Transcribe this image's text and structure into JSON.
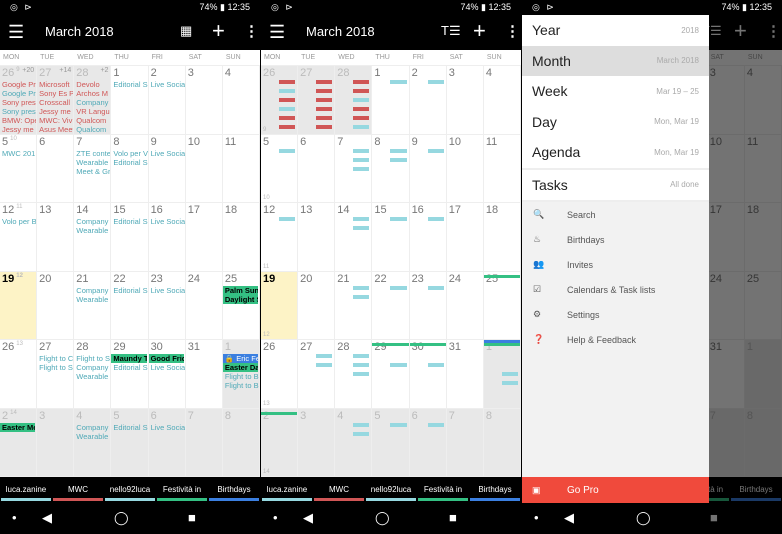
{
  "status": {
    "left_icons": "◎ ⊳",
    "right": "74% ▮ 12:35"
  },
  "appbar": {
    "menu_icon": "☰",
    "title": "March 2018",
    "action1_p1": "▦",
    "action1_p2": "T☰",
    "add": "+",
    "more": "⋮"
  },
  "dow": [
    "MON",
    "TUE",
    "WED",
    "THU",
    "FRI",
    "SAT",
    "SUN"
  ],
  "weeks": [
    {
      "wk": "9",
      "days": [
        {
          "n": "26",
          "out": true,
          "more": "+20",
          "ev": [
            [
              "Google Pr",
              "r"
            ],
            [
              "Google Pr",
              "c"
            ],
            [
              "Sony pres",
              "r"
            ],
            [
              "Sony pres",
              "c"
            ],
            [
              "BMW: Ope",
              "r"
            ],
            [
              "Jessy me",
              "r"
            ]
          ]
        },
        {
          "n": "27",
          "out": true,
          "more": "+14",
          "ev": [
            [
              "Microsoft",
              "r"
            ],
            [
              "Sony Es P",
              "r"
            ],
            [
              "Crosscall",
              "r"
            ],
            [
              "Jessy me",
              "r"
            ],
            [
              "MWC: Viv",
              "r"
            ],
            [
              "Asus Meet",
              "r"
            ]
          ]
        },
        {
          "n": "28",
          "out": true,
          "more": "+2",
          "ev": [
            [
              "Devolo",
              "r"
            ],
            [
              "Archos M",
              "r"
            ],
            [
              "Company I",
              "c"
            ],
            [
              "VR Langu",
              "r"
            ],
            [
              "Qualcom",
              "r"
            ],
            [
              "Qualcom",
              "c"
            ]
          ]
        },
        {
          "n": "1",
          "ev": [
            [
              "Editorial S",
              "c"
            ]
          ]
        },
        {
          "n": "2",
          "ev": [
            [
              "Live Socia",
              "c"
            ]
          ]
        },
        {
          "n": "3",
          "ev": []
        },
        {
          "n": "4",
          "ev": []
        }
      ]
    },
    {
      "wk": "10",
      "days": [
        {
          "n": "5",
          "ev": [
            [
              "MWC 201",
              "c"
            ]
          ]
        },
        {
          "n": "6",
          "ev": []
        },
        {
          "n": "7",
          "ev": [
            [
              "ZTE conte",
              "c"
            ],
            [
              "Wearable",
              "c"
            ],
            [
              "Meet & Gr",
              "c"
            ]
          ]
        },
        {
          "n": "8",
          "ev": [
            [
              "Volo per V",
              "c"
            ],
            [
              "Editorial S",
              "c"
            ]
          ]
        },
        {
          "n": "9",
          "ev": [
            [
              "Live Socia",
              "c"
            ]
          ]
        },
        {
          "n": "10",
          "ev": []
        },
        {
          "n": "11",
          "ev": []
        }
      ]
    },
    {
      "wk": "11",
      "days": [
        {
          "n": "12",
          "ev": [
            [
              "Volo per B",
              "c"
            ]
          ]
        },
        {
          "n": "13",
          "ev": []
        },
        {
          "n": "14",
          "ev": [
            [
              "Company I",
              "c"
            ],
            [
              "Wearable",
              "c"
            ]
          ]
        },
        {
          "n": "15",
          "ev": [
            [
              "Editorial S",
              "c"
            ]
          ]
        },
        {
          "n": "16",
          "ev": [
            [
              "Live Socia",
              "c"
            ]
          ]
        },
        {
          "n": "17",
          "ev": []
        },
        {
          "n": "18",
          "ev": []
        }
      ]
    },
    {
      "wk": "12",
      "days": [
        {
          "n": "19",
          "today": true,
          "ev": []
        },
        {
          "n": "20",
          "ev": []
        },
        {
          "n": "21",
          "ev": [
            [
              "Company I",
              "c"
            ],
            [
              "Wearable",
              "c"
            ]
          ]
        },
        {
          "n": "22",
          "ev": [
            [
              "Editorial S",
              "c"
            ]
          ]
        },
        {
          "n": "23",
          "ev": [
            [
              "Live Socia",
              "c"
            ]
          ]
        },
        {
          "n": "24",
          "ev": []
        },
        {
          "n": "25",
          "ev": [
            [
              "Palm Sun",
              "g"
            ],
            [
              "Daylight S",
              "g"
            ]
          ]
        }
      ]
    },
    {
      "wk": "13",
      "days": [
        {
          "n": "26",
          "ev": []
        },
        {
          "n": "27",
          "ev": [
            [
              "Flight to C",
              "c"
            ],
            [
              "Flight to S",
              "c"
            ]
          ]
        },
        {
          "n": "28",
          "ev": [
            [
              "Flight to S",
              "c"
            ],
            [
              "Company I",
              "c"
            ],
            [
              "Wearable",
              "c"
            ]
          ]
        },
        {
          "n": "29",
          "ev": [
            [
              "Maundy T",
              "g"
            ],
            [
              "Editorial S",
              "c"
            ]
          ]
        },
        {
          "n": "30",
          "ev": [
            [
              "Good Frid",
              "g"
            ],
            [
              "Live Socia",
              "c"
            ]
          ]
        },
        {
          "n": "31",
          "ev": []
        },
        {
          "n": "1",
          "out": true,
          "ev": [
            [
              "🔒 Eric Ferr",
              "b"
            ],
            [
              "Easter Day",
              "g"
            ],
            [
              "Flight to B",
              "c"
            ],
            [
              "Flight to B",
              "c"
            ]
          ]
        }
      ]
    },
    {
      "wk": "14",
      "days": [
        {
          "n": "2",
          "out": true,
          "ev": [
            [
              "Easter Mo",
              "g"
            ]
          ]
        },
        {
          "n": "3",
          "out": true,
          "ev": []
        },
        {
          "n": "4",
          "out": true,
          "ev": [
            [
              "Company I",
              "c"
            ],
            [
              "Wearable",
              "c"
            ]
          ]
        },
        {
          "n": "5",
          "out": true,
          "ev": [
            [
              "Editorial S",
              "c"
            ]
          ]
        },
        {
          "n": "6",
          "out": true,
          "ev": [
            [
              "Live Socia",
              "c"
            ]
          ]
        },
        {
          "n": "7",
          "out": true,
          "ev": []
        },
        {
          "n": "8",
          "out": true,
          "ev": []
        }
      ]
    }
  ],
  "calendars": [
    {
      "name": "luca.zanine",
      "color": "#96d8e0"
    },
    {
      "name": "MWC",
      "color": "#d05656"
    },
    {
      "name": "nello92luca",
      "color": "#96d8e0"
    },
    {
      "name": "Festività in",
      "color": "#34c083"
    },
    {
      "name": "Birthdays",
      "color": "#3b7fe0"
    }
  ],
  "navbar": {
    "dot": "•",
    "back": "◀",
    "home": "◯",
    "recent": "■"
  },
  "drawer": {
    "views": [
      {
        "name": "Year",
        "sub": "2018"
      },
      {
        "name": "Month",
        "sub": "March 2018",
        "selected": true
      },
      {
        "name": "Week",
        "sub": "Mar 19 – 25"
      },
      {
        "name": "Day",
        "sub": "Mon, Mar 19"
      },
      {
        "name": "Agenda",
        "sub": "Mon, Mar 19"
      }
    ],
    "tasks": {
      "name": "Tasks",
      "sub": "All done"
    },
    "menu": [
      {
        "icon": "🔍",
        "label": "Search"
      },
      {
        "icon": "♨",
        "label": "Birthdays"
      },
      {
        "icon": "👥",
        "label": "Invites"
      },
      {
        "icon": "☑",
        "label": "Calendars & Task lists"
      },
      {
        "icon": "⚙",
        "label": "Settings"
      },
      {
        "icon": "❓",
        "label": "Help & Feedback"
      }
    ],
    "gopro": {
      "icon": "▣",
      "label": "Go Pro"
    }
  }
}
